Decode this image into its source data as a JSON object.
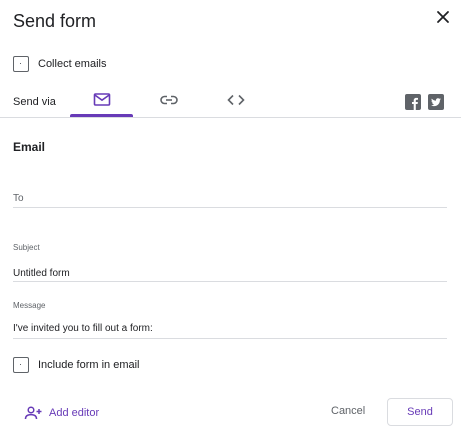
{
  "dialog": {
    "title": "Send form"
  },
  "collect_emails": {
    "label": "Collect emails",
    "checked": false
  },
  "send_via": {
    "label": "Send via",
    "tabs": [
      {
        "name": "email",
        "icon": "mail-icon",
        "selected": true
      },
      {
        "name": "link",
        "icon": "link-icon",
        "selected": false
      },
      {
        "name": "embed",
        "icon": "code-icon",
        "selected": false
      }
    ],
    "social": [
      {
        "name": "facebook",
        "icon": "facebook-icon"
      },
      {
        "name": "twitter",
        "icon": "twitter-icon"
      }
    ]
  },
  "email": {
    "section_title": "Email",
    "to": {
      "placeholder": "To",
      "value": ""
    },
    "subject": {
      "label": "Subject",
      "value": "Untitled form"
    },
    "message": {
      "label": "Message",
      "value": "I've invited you to fill out a form:"
    },
    "include_form": {
      "label": "Include form in email",
      "checked": false
    }
  },
  "footer": {
    "add_editor_label": "Add editor",
    "cancel_label": "Cancel",
    "send_label": "Send"
  },
  "colors": {
    "accent": "#673ab7",
    "icon": "#5f6368",
    "divider": "#dadce0",
    "text": "#202124"
  }
}
